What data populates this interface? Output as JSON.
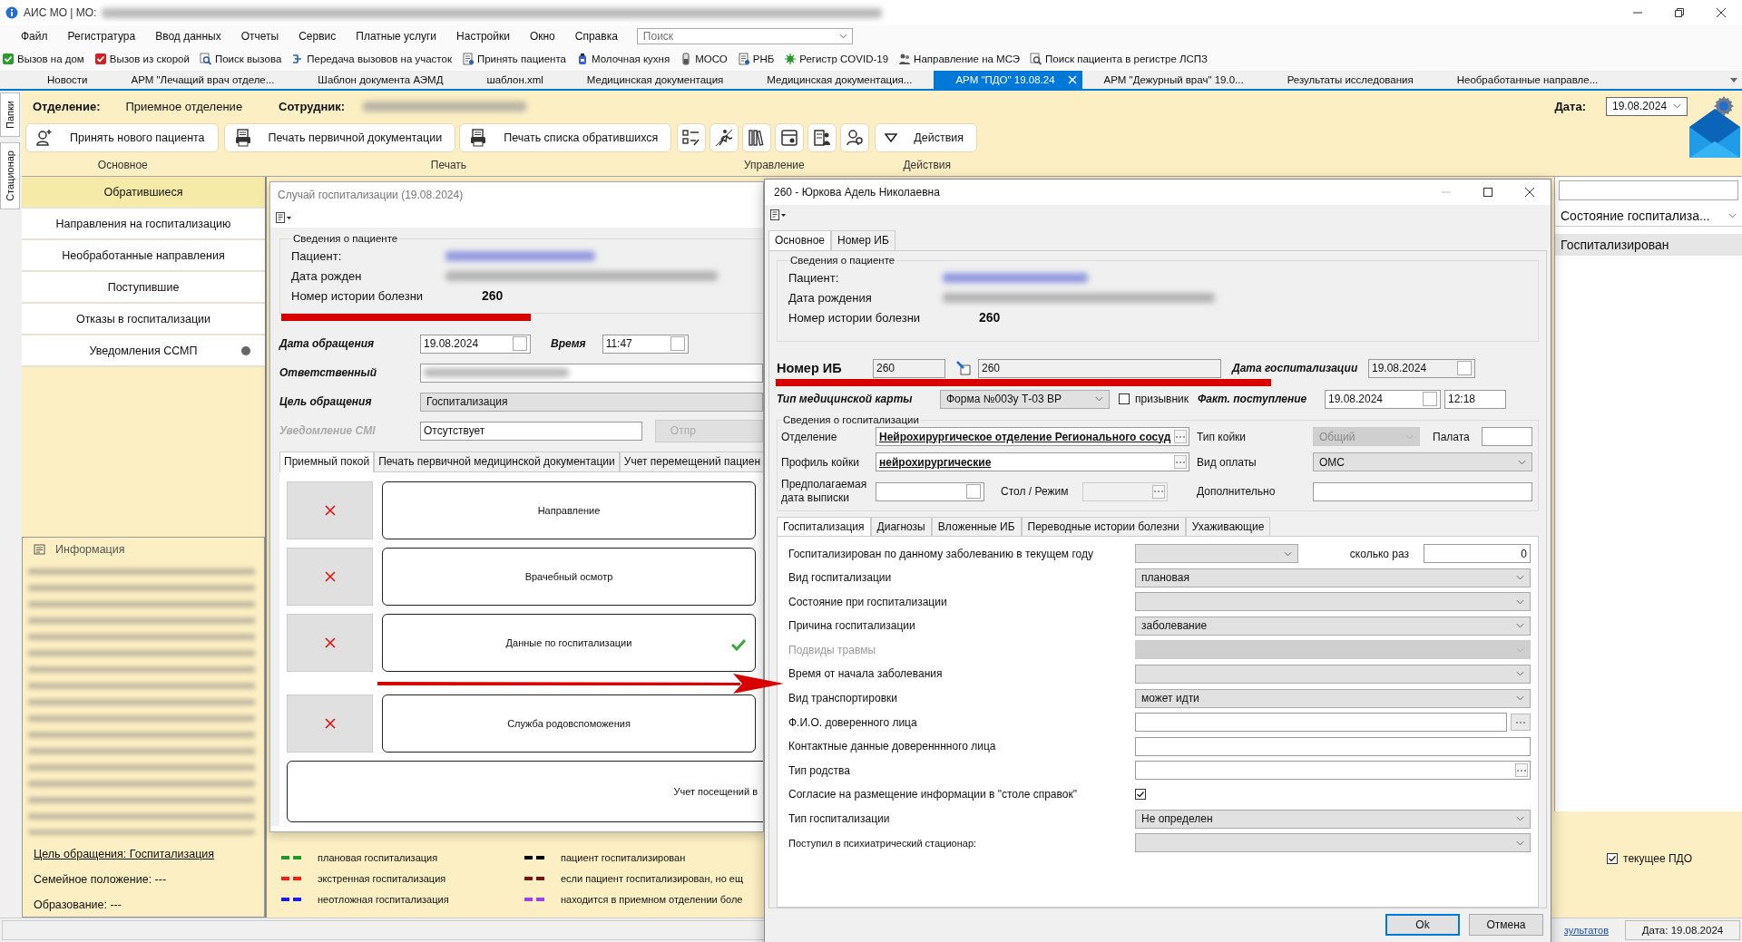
{
  "window": {
    "title": "АИС МО | МО:"
  },
  "menu": [
    "Файл",
    "Регистратура",
    "Ввод данных",
    "Отчеты",
    "Сервис",
    "Платные услуги",
    "Настройки",
    "Окно",
    "Справка"
  ],
  "search": {
    "placeholder": "Поиск"
  },
  "toolbar": [
    "Вызов на дом",
    "Вызов из скорой",
    "Поиск вызова",
    "Передача вызовов на участок",
    "Принять пациента",
    "Молочная кухня",
    "МОСО",
    "РНБ",
    "Регистр COVID-19",
    "Направление на МСЭ",
    "Поиск пациента в регистре ЛСПЗ"
  ],
  "doc_tabs": [
    {
      "label": "Новости",
      "selected": false
    },
    {
      "label": "АРМ \"Лечащий врач отделе...",
      "selected": false
    },
    {
      "label": "Шаблон документа АЭМД",
      "selected": false
    },
    {
      "label": "шаблон.xml",
      "selected": false
    },
    {
      "label": "Медицинская документация",
      "selected": false
    },
    {
      "label": "Медицинская документация...",
      "selected": false
    },
    {
      "label": "АРМ \"ПДО\" 19.08.24",
      "selected": true
    },
    {
      "label": "АРМ \"Дежурный врач\" 19.0...",
      "selected": false
    },
    {
      "label": "Результаты исследования",
      "selected": false
    },
    {
      "label": "Необработанные направле...",
      "selected": false
    }
  ],
  "side_strip": [
    "Папки",
    "Стационар"
  ],
  "header": {
    "department_label": "Отделение:",
    "department": "Приемное отделение",
    "employee_label": "Сотрудник:",
    "date_label": "Дата:",
    "date": "19.08.2024"
  },
  "ribbon": [
    {
      "group": "Основное",
      "buttons": [
        {
          "kind": "text",
          "label": "Принять нового пациента"
        }
      ]
    },
    {
      "group": "Печать",
      "buttons": [
        {
          "kind": "text",
          "label": "Печать первичной документации"
        },
        {
          "kind": "text",
          "label": "Печать списка обратившихся"
        }
      ]
    },
    {
      "group": "Управление",
      "buttons": [
        {
          "kind": "icon"
        },
        {
          "kind": "icon"
        },
        {
          "kind": "icon"
        },
        {
          "kind": "icon"
        },
        {
          "kind": "icon"
        },
        {
          "kind": "icon"
        }
      ]
    },
    {
      "group": "Действия",
      "buttons": [
        {
          "kind": "menu",
          "label": "Действия"
        }
      ]
    }
  ],
  "sidebar": [
    {
      "label": "Обратившиеся",
      "selected": true,
      "notification_dot": false
    },
    {
      "label": "Направления на госпитализацию",
      "selected": false,
      "notification_dot": false
    },
    {
      "label": "Необработанные направления",
      "selected": false,
      "notification_dot": false
    },
    {
      "label": "Поступившие",
      "selected": false,
      "notification_dot": false
    },
    {
      "label": "Отказы в госпитализации",
      "selected": false,
      "notification_dot": false
    },
    {
      "label": "Уведомления ССМП",
      "selected": false,
      "notification_dot": true
    }
  ],
  "info": {
    "title": "Информация",
    "lines": [
      {
        "text": "Цель обращения: Госпитализация",
        "link": true
      },
      {
        "text": "Семейное положение: ---",
        "link": false
      },
      {
        "text": "Образование: ---",
        "link": false
      }
    ]
  },
  "case_window": {
    "title": "Случай госпитализации (19.08.2024)",
    "patient_group": "Сведения о пациенте",
    "patient_label": "Пациент:",
    "birth_label": "Дата рожден",
    "history_label": "Номер истории болезни",
    "history": "260",
    "fields": [
      {
        "kind": "date",
        "label": "Дата обращения",
        "value": "19.08.2024",
        "extra_label": "Время",
        "extra_value": "11:47",
        "disabled": false
      },
      {
        "kind": "blurred",
        "label": "Ответственный",
        "disabled": false
      },
      {
        "kind": "select",
        "label": "Цель обращения",
        "value": "Госпитализация",
        "disabled": false
      },
      {
        "kind": "text",
        "label": "Уведомление СМI",
        "value": "Отсутствует",
        "button": "Отпр",
        "disabled": true
      }
    ],
    "tabs": [
      {
        "label": "Приемный покой",
        "selected": true
      },
      {
        "label": "Печать первичной медицинской документации",
        "selected": false
      },
      {
        "label": "Учет перемещений пациен",
        "selected": false
      }
    ],
    "steps": [
      {
        "label": "Направление",
        "done": false
      },
      {
        "label": "Врачебный осмотр",
        "done": false
      },
      {
        "label": "Данные по госпитализации",
        "done": true
      },
      {
        "label": "Служба родовспоможения",
        "done": false
      }
    ],
    "footer_step": "Учет посещений в"
  },
  "legend": [
    {
      "color": "#1f9a2a",
      "label": "плановая госпитализация"
    },
    {
      "color": "#000000",
      "label": "пациент госпитализирован"
    },
    {
      "color": "#ff1a1a",
      "label": "экстренная госпитализация"
    },
    {
      "color": "#7a1212",
      "label": "если пациент госпитализирован, но ещ"
    },
    {
      "color": "#1a1aee",
      "label": "неотложная госпитализация"
    },
    {
      "color": "#a040e0",
      "label": "находится в приемном отделении боле"
    }
  ],
  "right_panel": {
    "column": "Состояние госпитализа...",
    "rows": [
      "Госпитализирован"
    ],
    "current_pdo": {
      "label": "текущее ПДО",
      "checked": true
    }
  },
  "status_bar": {
    "link": "зультатов",
    "date": "Дата: 19.08.2024"
  },
  "dialog": {
    "title": "260 - Юркова Адель Николаевна",
    "tabs": [
      {
        "label": "Основное",
        "selected": true
      },
      {
        "label": "Номер ИБ",
        "selected": false
      }
    ],
    "patient_group": "Сведения о пациенте",
    "patient_label": "Пациент:",
    "birth_label": "Дата рождения",
    "history_label": "Номер истории болезни",
    "history": "260",
    "ib": {
      "label": "Номер ИБ",
      "value": "260",
      "full_value": "260"
    },
    "hosp_date": {
      "label": "Дата госпитализации",
      "value": "19.08.2024"
    },
    "card_type": {
      "label": "Тип медицинской карты",
      "value": "Форма №003у Т-03 ВР"
    },
    "conscript": {
      "label": "призывник",
      "checked": false
    },
    "admission": {
      "label": "Факт. поступление",
      "date": "19.08.2024",
      "time": "12:18"
    },
    "hosp_group": "Сведения о госпитализации",
    "department": {
      "label": "Отделение",
      "value": "Нейрохирургическое отделение Регионального сосуд"
    },
    "bed_type": {
      "label": "Тип койки",
      "value": "Общий"
    },
    "ward": {
      "label": "Палата"
    },
    "bed_profile": {
      "label": "Профиль койки",
      "value": "нейрохирургические"
    },
    "payment": {
      "label": "Вид оплаты",
      "value": "ОМС"
    },
    "discharge": {
      "label": "Предполагаемая дата выписки"
    },
    "diet": {
      "label": "Стол / Режим"
    },
    "extra": {
      "label": "Дополнительно"
    },
    "inner_tabs": [
      {
        "label": "Госпитализация",
        "selected": true
      },
      {
        "label": "Диагнозы",
        "selected": false
      },
      {
        "label": "Вложенные ИБ",
        "selected": false
      },
      {
        "label": "Переводные истории болезни",
        "selected": false
      },
      {
        "label": "Ухаживающие",
        "selected": false
      }
    ],
    "rows": [
      {
        "kind": "select",
        "label": "Госпитализирован по данному заболеванию в текущем году",
        "count_label": "сколько раз",
        "count": "0",
        "disabled": false
      },
      {
        "kind": "select",
        "label": "Вид госпитализации",
        "value": "плановая",
        "disabled": false
      },
      {
        "kind": "select",
        "label": "Состояние при госпитализации",
        "disabled": false
      },
      {
        "kind": "select",
        "label": "Причина госпитализации",
        "value": "заболевание",
        "disabled": false
      },
      {
        "kind": "select",
        "label": "Подвиды травмы",
        "disabled": true
      },
      {
        "kind": "select",
        "label": "Время от начала заболевания",
        "disabled": false
      },
      {
        "kind": "select",
        "label": "Вид транспортировки",
        "value": "может идти",
        "disabled": false
      },
      {
        "kind": "picker",
        "label": "Ф.И.О. доверенного лица",
        "disabled": false
      },
      {
        "kind": "text",
        "label": "Контактные данные доверенннного лица",
        "disabled": false
      },
      {
        "kind": "picker_inline",
        "label": "Тип родства",
        "disabled": false
      },
      {
        "kind": "checkbox",
        "label": "Согласие на размещение информации в \"столе справок\"",
        "checked": true,
        "disabled": false
      },
      {
        "kind": "select",
        "label": "Тип госпитализации",
        "value": "Не определен",
        "disabled": false
      },
      {
        "kind": "select_small",
        "label": "Поступил в психиатрический стационар:",
        "disabled": false
      }
    ],
    "buttons": [
      "Ok",
      "Отмена"
    ]
  }
}
